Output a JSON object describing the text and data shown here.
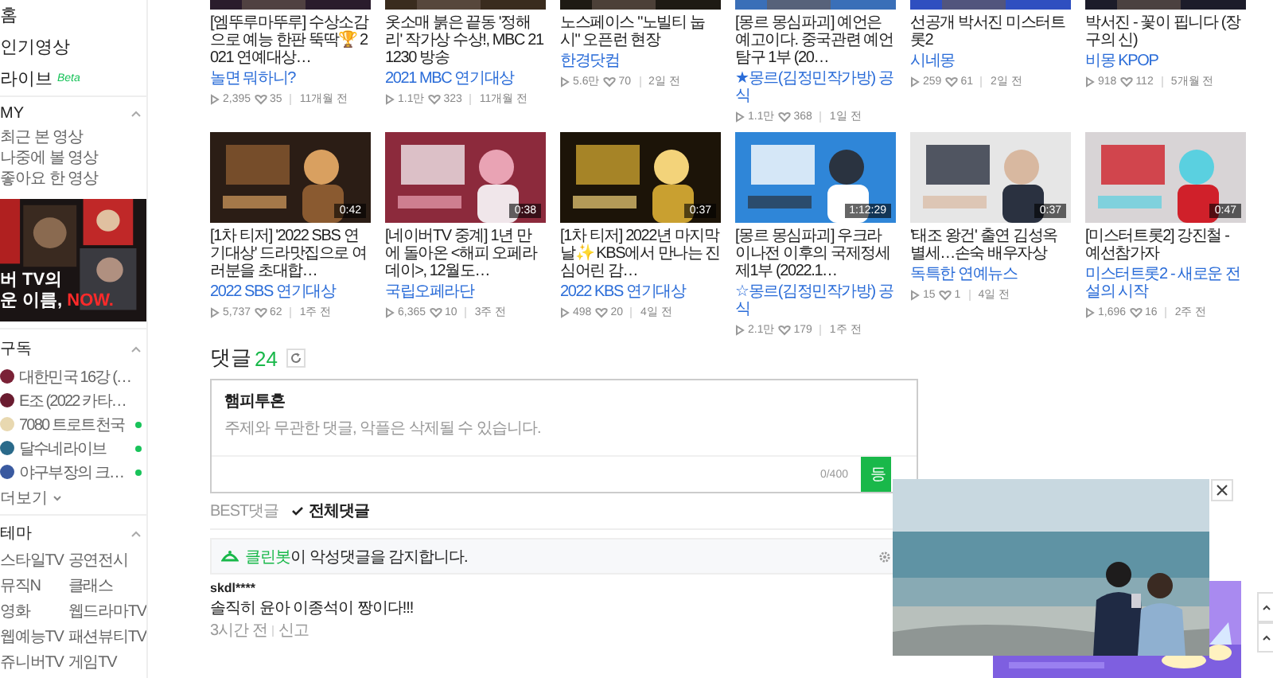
{
  "sidebar": {
    "menu": [
      {
        "label": "홈"
      },
      {
        "label": "인기영상"
      },
      {
        "label": "라이브",
        "badge": "Beta"
      }
    ],
    "my": {
      "title": "MY",
      "items": [
        "최근 본 영상",
        "나중에 볼 영상",
        "좋아요 한 영상"
      ]
    },
    "banner": {
      "line_1": "버 TV의",
      "line_2": "운 이름,",
      "highlight": "NOW."
    },
    "subscriptions": {
      "title": "구독",
      "items": [
        {
          "name": "대한민국 16강 (…",
          "live": false
        },
        {
          "name": "E조 (2022 카타…",
          "live": false
        },
        {
          "name": "7080 트로트천국",
          "live": true
        },
        {
          "name": "달수네라이브",
          "live": true
        },
        {
          "name": "야구부장의 크…",
          "live": true
        }
      ],
      "more": "더보기"
    },
    "themes": {
      "title": "테마",
      "items": [
        "스타일TV",
        "공연전시",
        "뮤직N",
        "클래스",
        "영화",
        "웹드라마TV",
        "웹예능TV",
        "패션뷰티TV",
        "쥬니버TV",
        "게임TV"
      ]
    }
  },
  "videos_top": [
    {
      "title": "[엠뚜루마뚜루] 수상소감으로 예능 한판 뚝딱🏆 2021 연예대상…",
      "channel": "놀면 뭐하니?",
      "views": "2,395",
      "likes": "35",
      "age": "11개월 전"
    },
    {
      "title": "옷소매 붉은 끝동 '정해리' 작가상 수상!, MBC 211230 방송",
      "channel": "2021 MBC 연기대상",
      "views": "1.1만",
      "likes": "323",
      "age": "11개월 전"
    },
    {
      "title": "노스페이스 \"노빌티 눕시\" 오픈런 현장",
      "channel": "한경닷컴",
      "views": "5.6만",
      "likes": "70",
      "age": "2일 전"
    },
    {
      "title": "[몽르 몽심파괴] 예언은 예고이다. 중국관련 예언탐구 1부 (20…",
      "channel": "★몽르(김정민작가방) 공식",
      "views": "1.1만",
      "likes": "368",
      "age": "1일 전"
    },
    {
      "title": "선공개 박서진 미스터트롯2",
      "channel": "시네몽",
      "views": "259",
      "likes": "61",
      "age": "2일 전"
    },
    {
      "title": "박서진 - 꽃이 핍니다 (장구의 신)",
      "channel": "비몽 KPOP",
      "views": "918",
      "likes": "112",
      "age": "5개월 전"
    }
  ],
  "videos": [
    {
      "duration": "0:42",
      "title": "[1차 티저] '2022 SBS 연기대상' 드라맛집으로 여러분을 초대합…",
      "channel": "2022 SBS 연기대상",
      "views": "5,737",
      "likes": "62",
      "age": "1주 전"
    },
    {
      "duration": "0:38",
      "title": "[네이버TV 중계] 1년 만에 돌아온 <해피 오페라 데이>, 12월도…",
      "channel": "국립오페라단",
      "views": "6,365",
      "likes": "10",
      "age": "3주 전"
    },
    {
      "duration": "0:37",
      "title": "[1차 티저] 2022년 마지막 날✨ KBS에서 만나는 진심어린 감…",
      "channel": "2022 KBS 연기대상",
      "views": "498",
      "likes": "20",
      "age": "4일 전"
    },
    {
      "duration": "1:12:29",
      "title": "[몽르 몽심파괴] 우크라이나전 이후의 국제정세 제1부 (2022.1…",
      "channel": "☆몽르(김정민작가방) 공식",
      "views": "2.1만",
      "likes": "179",
      "age": "1주 전"
    },
    {
      "duration": "0:37",
      "title": "'태조 왕건' 출연 김성옥 별세…손숙 배우자상",
      "channel": "독특한 연예뉴스",
      "views": "15",
      "likes": "1",
      "age": "4일 전"
    },
    {
      "duration": "0:47",
      "title": "[미스터트롯2] 강진철 - 예선참가자",
      "channel": "미스터트롯2 - 새로운 전설의 시작",
      "views": "1,696",
      "likes": "16",
      "age": "2주 전"
    }
  ],
  "comments": {
    "title": "댓글",
    "count": "24",
    "user": "햄피투혼",
    "placeholder": "주제와 무관한 댓글, 악플은 삭제될 수 있습니다.",
    "counter": "0/400",
    "submit": "등",
    "sorts": [
      {
        "label": "BEST댓글",
        "selected": false
      },
      {
        "label": "전체댓글",
        "selected": true
      }
    ],
    "cleanbot": {
      "name": "클린봇",
      "text": "이 악성댓글을 감지합니다."
    },
    "list": [
      {
        "author": "skdl****",
        "text": "솔직히 윤아 이종석이 짱이다!!!",
        "time": "3시간 전",
        "report": "신고"
      }
    ]
  }
}
